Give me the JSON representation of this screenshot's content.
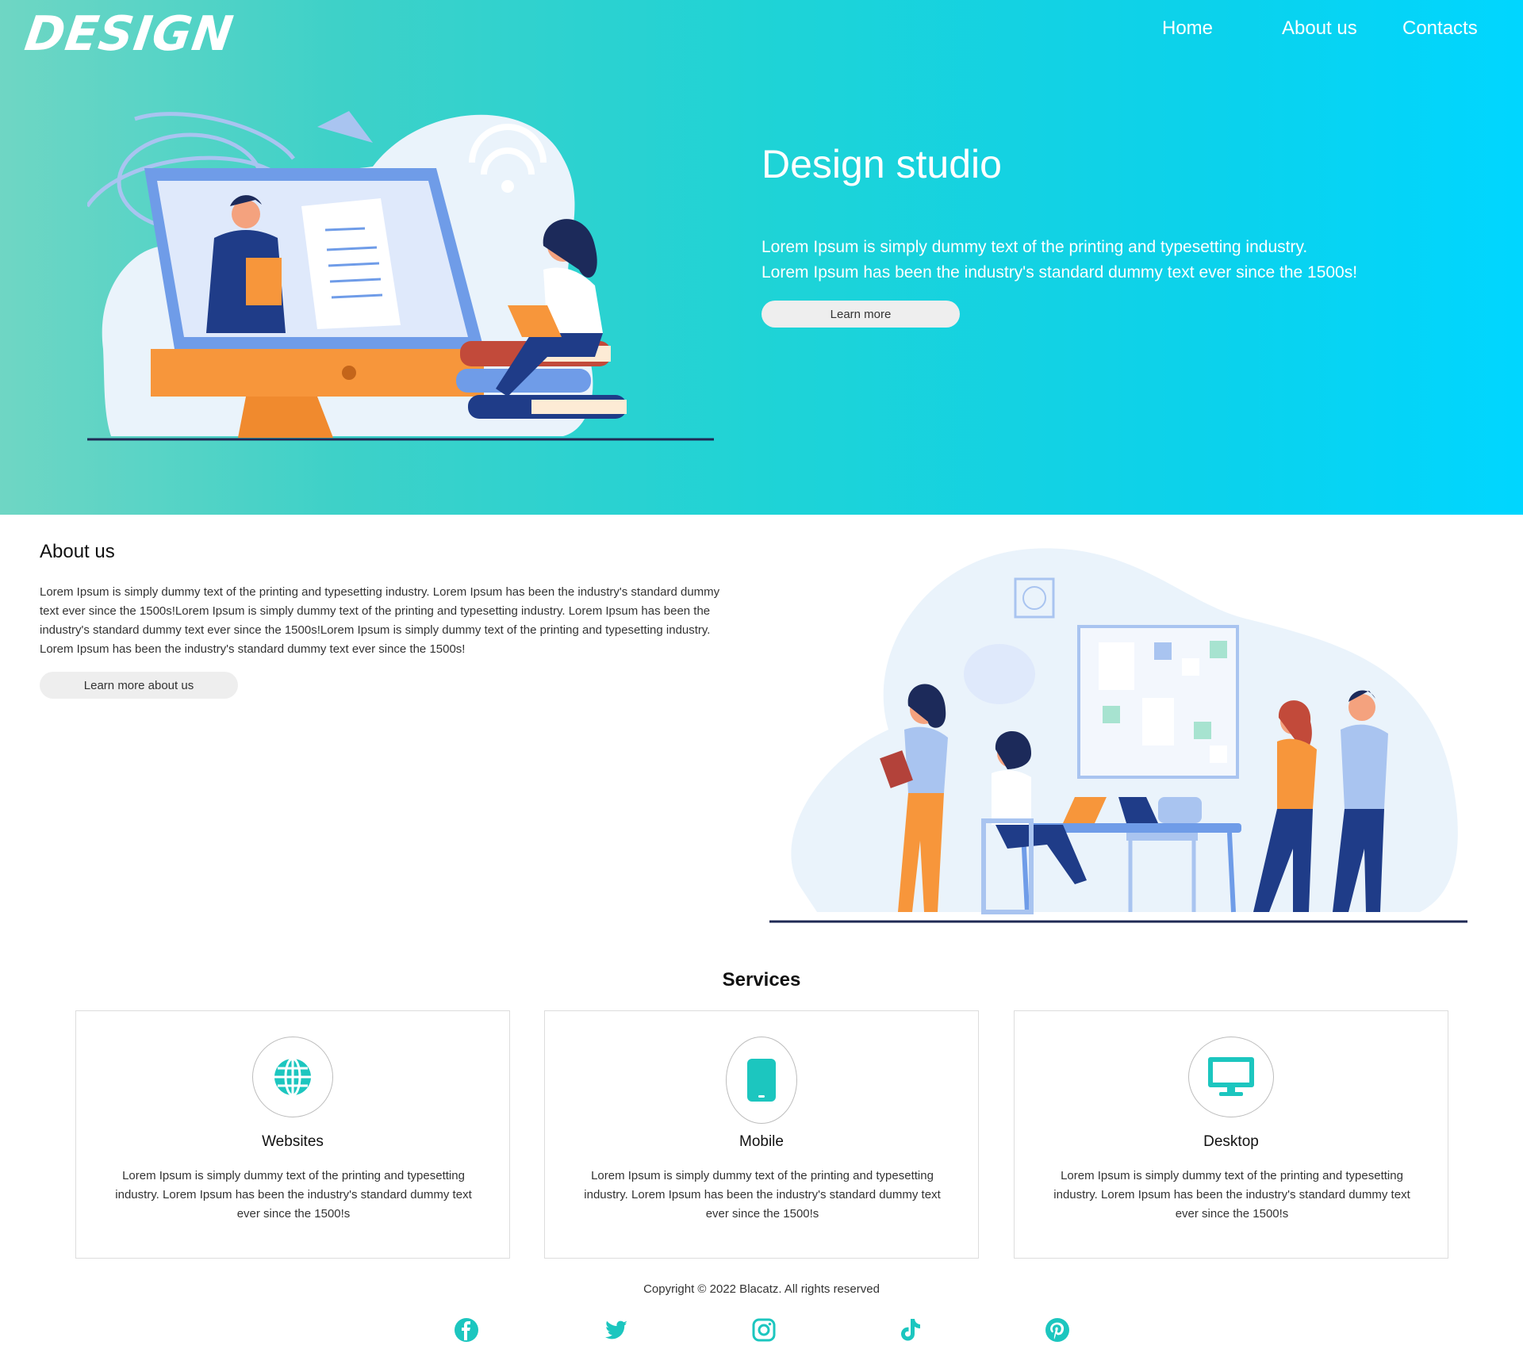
{
  "brand": {
    "logo_text": "DESIGN"
  },
  "nav": {
    "items": [
      {
        "label": "Home"
      },
      {
        "label": "About us"
      },
      {
        "label": "Contacts"
      }
    ]
  },
  "hero": {
    "title": "Design studio",
    "text_lines": [
      "Lorem Ipsum is simply dummy text of the printing and typesetting industry.",
      "Lorem Ipsum has been the industry's standard dummy text ever since the 1500s!"
    ],
    "button_label": "Learn more"
  },
  "about": {
    "title": "About us",
    "text_lines": [
      "Lorem Ipsum is simply dummy text of the printing and typesetting industry. Lorem Ipsum has been the industry's standard dummy",
      "text ever since the 1500s!Lorem Ipsum is simply dummy text of the printing and typesetting industry. Lorem Ipsum has been the",
      "industry's standard dummy text ever since the 1500s!Lorem Ipsum is simply dummy text of the printing and typesetting industry.",
      "Lorem Ipsum has been the industry's standard dummy text ever since the 1500s!"
    ],
    "button_label": "Learn more about us"
  },
  "services": {
    "title": "Services",
    "cards": [
      {
        "icon": "globe-icon",
        "title": "Websites",
        "text_lines": [
          "Lorem Ipsum is simply dummy text of the printing and typesetting",
          "industry. Lorem Ipsum has been the industry's standard dummy text",
          "ever since the 1500!s"
        ]
      },
      {
        "icon": "smartphone-icon",
        "title": "Mobile",
        "text_lines": [
          "Lorem Ipsum is simply dummy text of the printing and typesetting",
          "industry. Lorem Ipsum has been the industry's standard dummy text",
          "ever since the 1500!s"
        ]
      },
      {
        "icon": "desktop-icon",
        "title": "Desktop",
        "text_lines": [
          "Lorem Ipsum is simply dummy text of the printing and typesetting",
          "industry. Lorem Ipsum has been the industry's standard dummy text",
          "ever since the 1500!s"
        ]
      }
    ]
  },
  "footer": {
    "copyright": "Copyright © 2022 Blacatz. All rights reserved",
    "social_icons": [
      "facebook-icon",
      "twitter-icon",
      "instagram-icon",
      "tiktok-icon",
      "pinterest-icon"
    ]
  },
  "colors": {
    "hero_gradient_start": "#6fd6c4",
    "hero_gradient_end": "#00d6ff",
    "accent_teal": "#1cc6bf",
    "button_bg": "#eeeeee"
  }
}
